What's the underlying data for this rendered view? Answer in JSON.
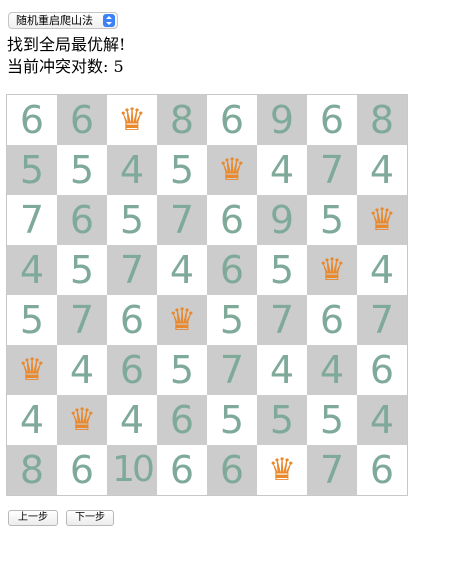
{
  "controls": {
    "algorithm_select": "随机重启爬山法",
    "prev_button": "上一步",
    "next_button": "下一步"
  },
  "status": {
    "message": "找到全局最优解!",
    "conflict_text": "当前冲突对数: 5"
  },
  "board": {
    "size": 8,
    "queen_symbol": "♛",
    "colors": {
      "light_square": "#ffffff",
      "dark_square": "#cccccc",
      "number": "#7faa9a",
      "queen": "#e8892e"
    },
    "rows": [
      [
        "6",
        "6",
        "Q",
        "8",
        "6",
        "9",
        "6",
        "8"
      ],
      [
        "5",
        "5",
        "4",
        "5",
        "Q",
        "4",
        "7",
        "4"
      ],
      [
        "7",
        "6",
        "5",
        "7",
        "6",
        "9",
        "5",
        "Q"
      ],
      [
        "4",
        "5",
        "7",
        "4",
        "6",
        "5",
        "Q",
        "4"
      ],
      [
        "5",
        "7",
        "6",
        "Q",
        "5",
        "7",
        "6",
        "7"
      ],
      [
        "Q",
        "4",
        "6",
        "5",
        "7",
        "4",
        "4",
        "6"
      ],
      [
        "4",
        "Q",
        "4",
        "6",
        "5",
        "5",
        "5",
        "4"
      ],
      [
        "8",
        "6",
        "10",
        "6",
        "6",
        "Q",
        "7",
        "6"
      ]
    ]
  }
}
